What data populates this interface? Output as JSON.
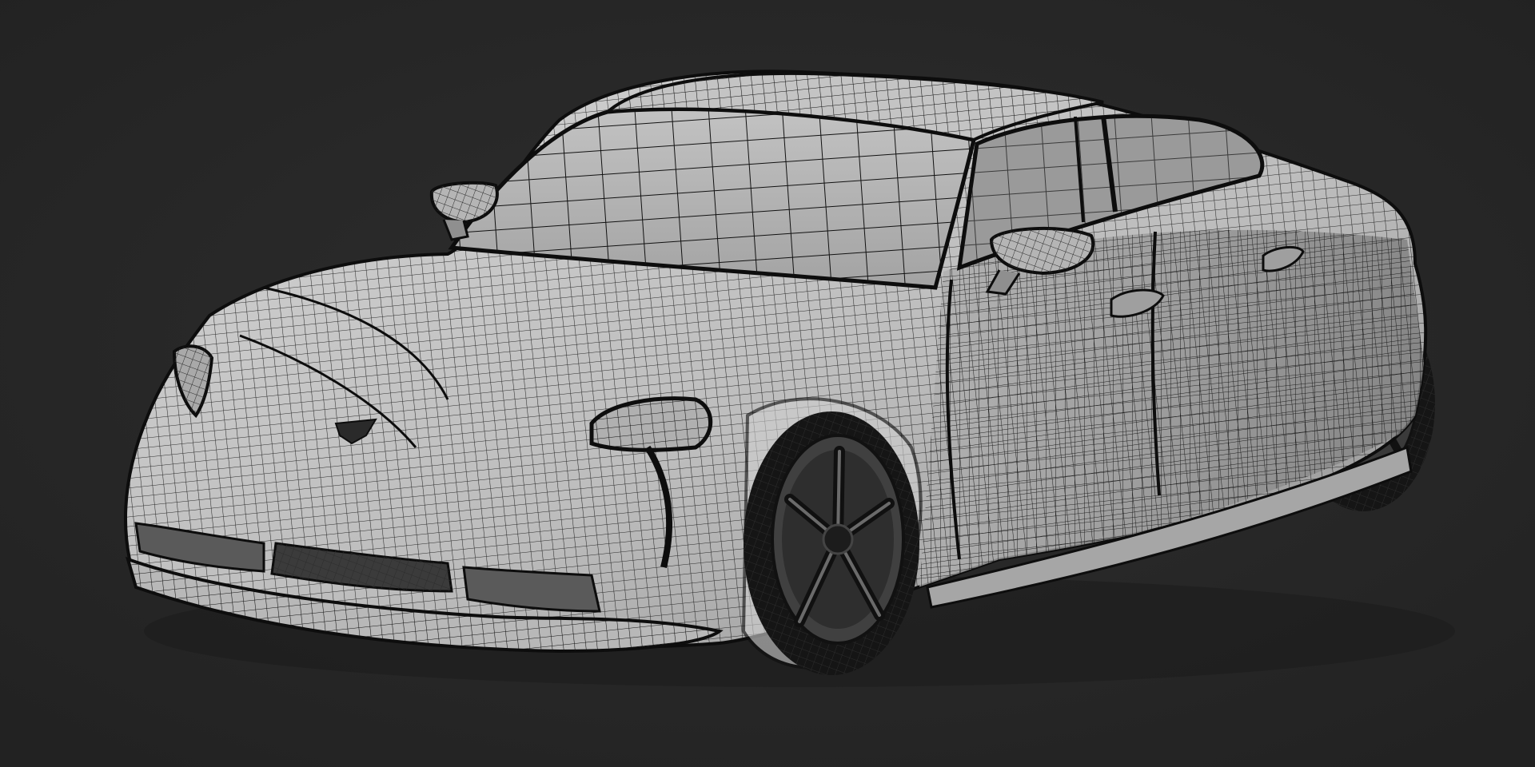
{
  "scene": {
    "subject": "sports-sedan-wireframe",
    "colors": {
      "background": "#262626",
      "vignette_center": "#2e2e2e",
      "body_fill": "#c9c9c9",
      "body_shadow": "#8f8f8f",
      "glass_fill": "#b4b4b4",
      "wire": "#101010",
      "tire": "#1a1a1a",
      "rim": "#5a5a5a"
    }
  }
}
